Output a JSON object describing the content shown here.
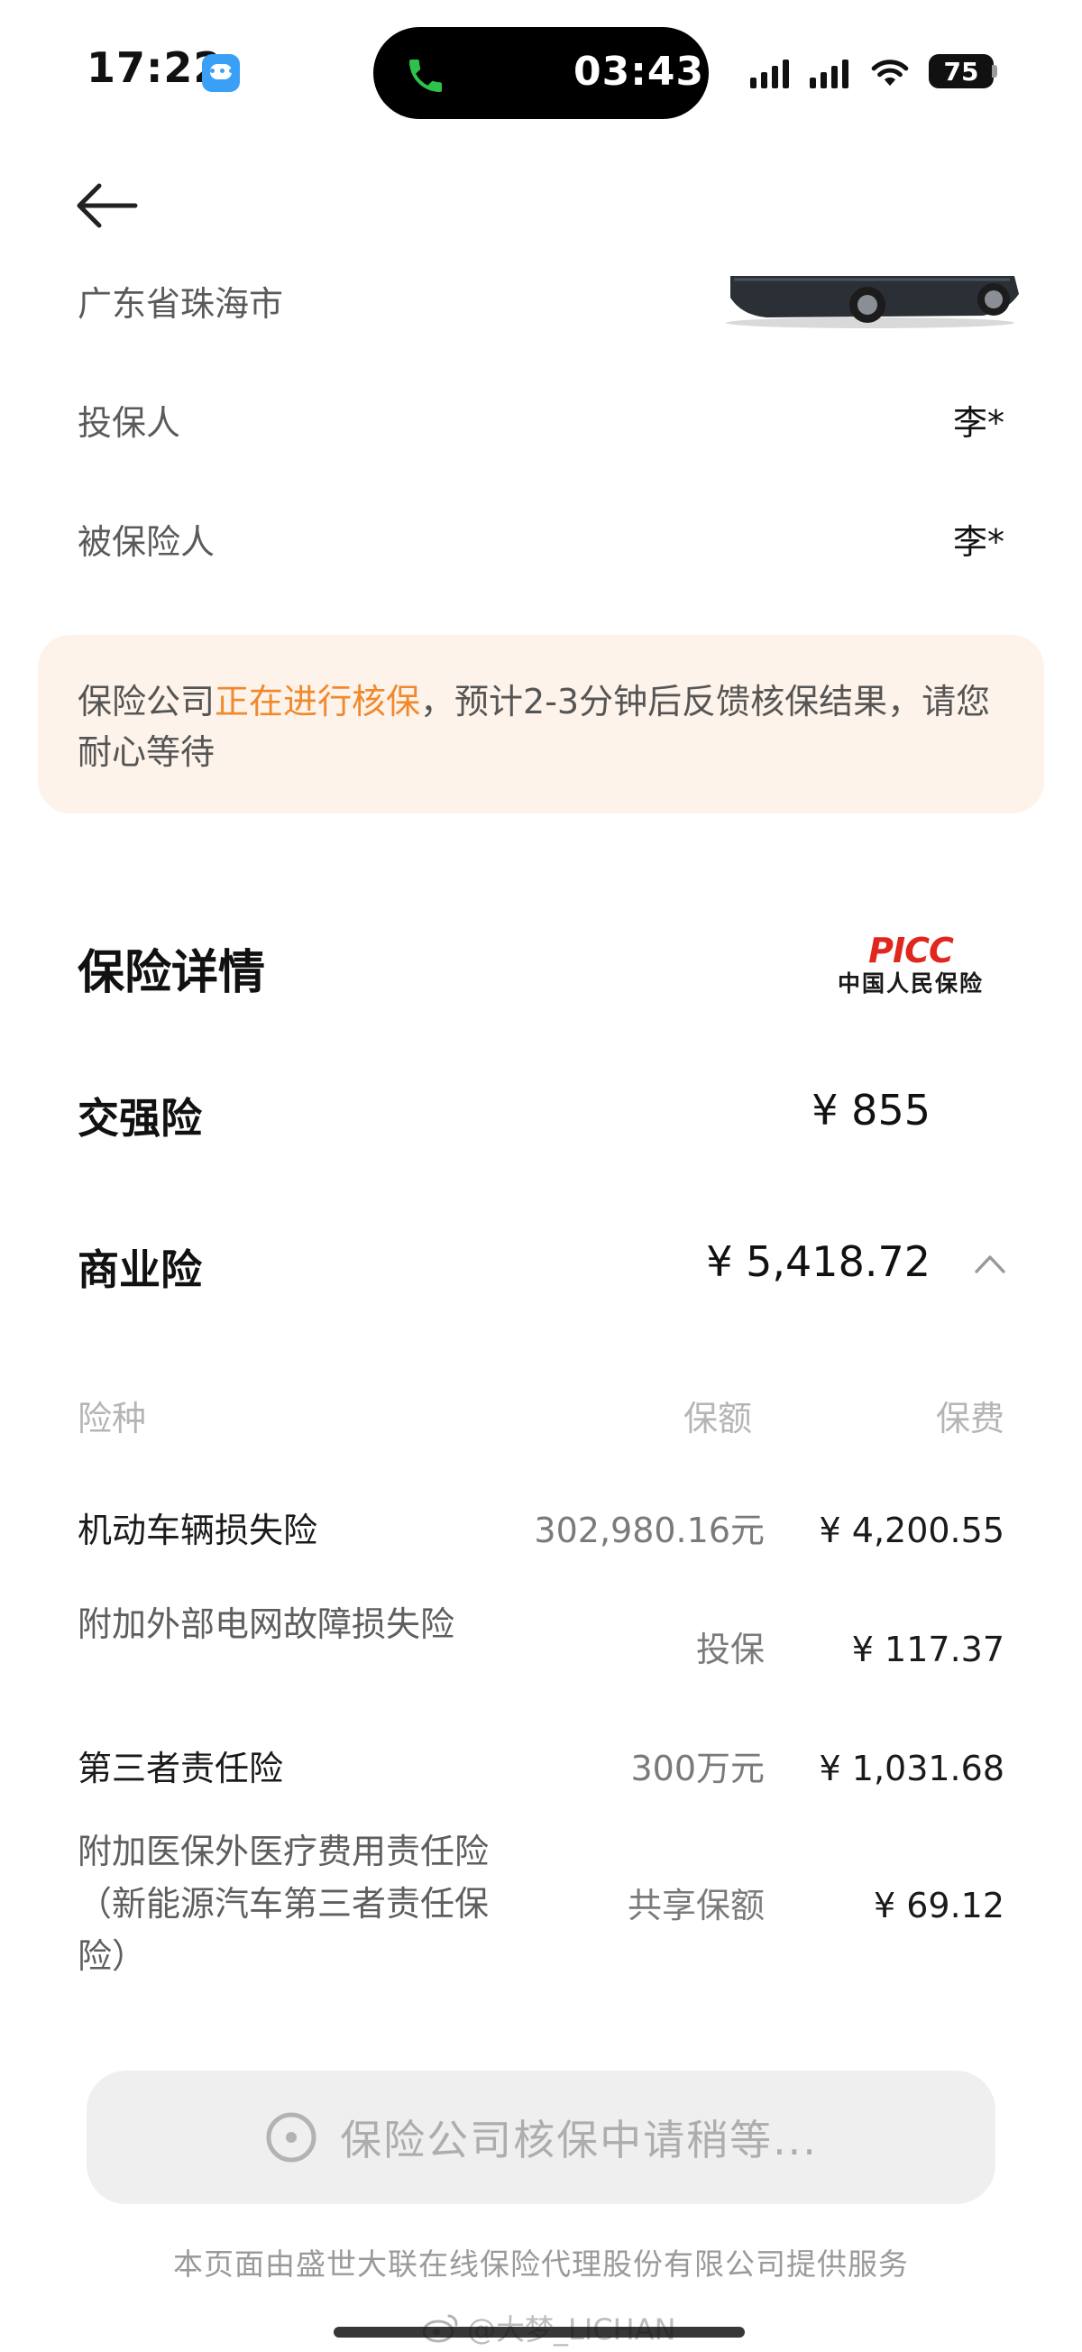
{
  "status_bar": {
    "time": "17:22",
    "call_timer": "03:43",
    "battery": "75"
  },
  "header": {
    "region": "广东省珠海市"
  },
  "info": {
    "policyholder_label": "投保人",
    "policyholder_value": "李*",
    "insured_label": "被保险人",
    "insured_value": "李*"
  },
  "notice": {
    "prefix": "保险公司",
    "highlight": "正在进行核保",
    "suffix": "，预计2-3分钟后反馈核保结果，请您耐心等待",
    "highlight_color": "#f0892d"
  },
  "details": {
    "title": "保险详情",
    "insurer_logo_top": "PICC",
    "insurer_logo_bottom": "中国人民保险",
    "compulsory": {
      "label": "交强险",
      "amount": "¥  855"
    },
    "commercial": {
      "label": "商业险",
      "amount": "¥  5,418.72"
    },
    "columns": {
      "type": "险种",
      "coverage": "保额",
      "premium": "保费"
    },
    "coverages": [
      {
        "name": "机动车辆损失险",
        "amount": "302,980.16元",
        "premium": "¥  4,200.55"
      },
      {
        "name": "附加外部电网故障损失险",
        "amount": "投保",
        "premium": "¥  117.37"
      },
      {
        "name": "第三者责任险",
        "amount": "300万元",
        "premium": "¥  1,031.68"
      },
      {
        "name": "附加医保外医疗费用责任险（新能源汽车第三者责任保险）",
        "amount": "共享保额",
        "premium": "¥  69.12"
      }
    ]
  },
  "bottom": {
    "wait_button": "保险公司核保中请稍等...",
    "footer": "本页面由盛世大联在线保险代理股份有限公司提供服务",
    "watermark": "@大梦_LICHAN"
  }
}
